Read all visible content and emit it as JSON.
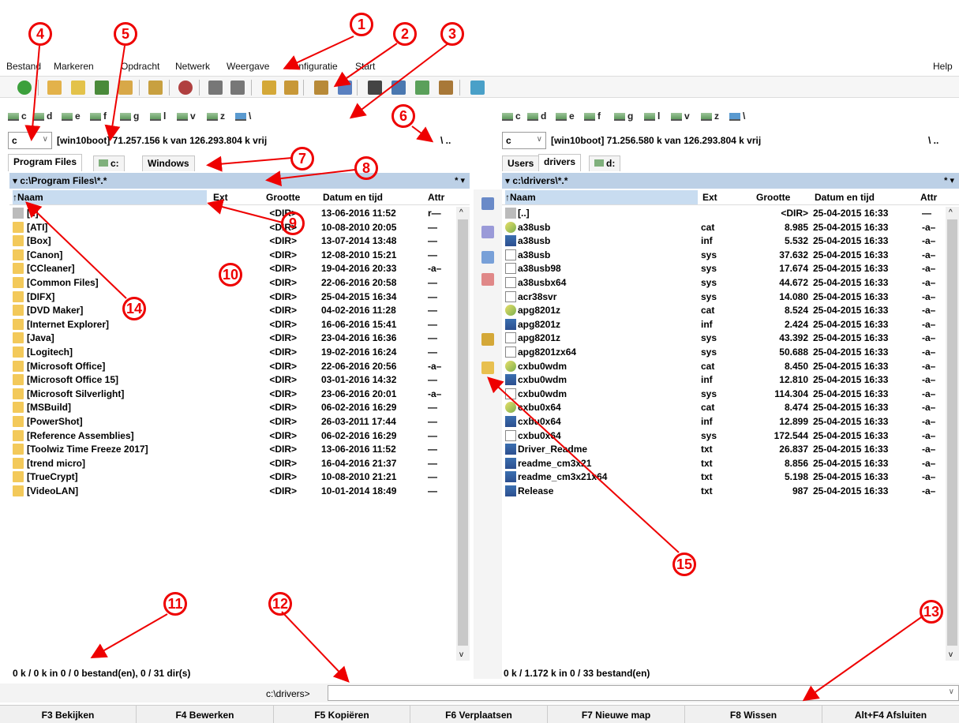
{
  "menu": {
    "items": [
      "Bestand",
      "Markeren",
      "Opdracht",
      "Netwerk",
      "Weergave",
      "Configuratie",
      "Start"
    ],
    "help": "Help"
  },
  "drives": {
    "left": [
      "c",
      "d",
      "e",
      "f",
      "g",
      "l",
      "v",
      "z",
      "\\"
    ],
    "right": [
      "c",
      "d",
      "e",
      "f",
      "g",
      "l",
      "v",
      "z",
      "\\"
    ]
  },
  "left": {
    "drive": "c",
    "free": "[win10boot]  71.257.156 k van 126.293.804 k vrij",
    "root": "\\   ..",
    "tabs": [
      "Program Files",
      "c:",
      "Windows"
    ],
    "path": "c:\\Program Files\\*.*",
    "filter": "*  ▾",
    "columns": {
      "name": "↑Naam",
      "ext": "Ext",
      "size": "Grootte",
      "date": "Datum en tijd",
      "attr": "Attr"
    },
    "rows": [
      {
        "name": "[..]",
        "ext": "",
        "size": "<DIR>",
        "date": "13-06-2016 11:52",
        "attr": "r—"
      },
      {
        "name": "[ATI]",
        "ext": "",
        "size": "<DIR>",
        "date": "10-08-2010 20:05",
        "attr": "—"
      },
      {
        "name": "[Box]",
        "ext": "",
        "size": "<DIR>",
        "date": "13-07-2014 13:48",
        "attr": "—"
      },
      {
        "name": "[Canon]",
        "ext": "",
        "size": "<DIR>",
        "date": "12-08-2010 15:21",
        "attr": "—"
      },
      {
        "name": "[CCleaner]",
        "ext": "",
        "size": "<DIR>",
        "date": "19-04-2016 20:33",
        "attr": "-a–"
      },
      {
        "name": "[Common Files]",
        "ext": "",
        "size": "<DIR>",
        "date": "22-06-2016 20:58",
        "attr": "—"
      },
      {
        "name": "[DIFX]",
        "ext": "",
        "size": "<DIR>",
        "date": "25-04-2015 16:34",
        "attr": "—"
      },
      {
        "name": "[DVD Maker]",
        "ext": "",
        "size": "<DIR>",
        "date": "04-02-2016 11:28",
        "attr": "—"
      },
      {
        "name": "[Internet Explorer]",
        "ext": "",
        "size": "<DIR>",
        "date": "16-06-2016 15:41",
        "attr": "—"
      },
      {
        "name": "[Java]",
        "ext": "",
        "size": "<DIR>",
        "date": "23-04-2016 16:36",
        "attr": "—"
      },
      {
        "name": "[Logitech]",
        "ext": "",
        "size": "<DIR>",
        "date": "19-02-2016 16:24",
        "attr": "—"
      },
      {
        "name": "[Microsoft Office]",
        "ext": "",
        "size": "<DIR>",
        "date": "22-06-2016 20:56",
        "attr": "-a–"
      },
      {
        "name": "[Microsoft Office 15]",
        "ext": "",
        "size": "<DIR>",
        "date": "03-01-2016 14:32",
        "attr": "—"
      },
      {
        "name": "[Microsoft Silverlight]",
        "ext": "",
        "size": "<DIR>",
        "date": "23-06-2016 20:01",
        "attr": "-a–"
      },
      {
        "name": "[MSBuild]",
        "ext": "",
        "size": "<DIR>",
        "date": "06-02-2016 16:29",
        "attr": "—"
      },
      {
        "name": "[PowerShot]",
        "ext": "",
        "size": "<DIR>",
        "date": "26-03-2011 17:44",
        "attr": "—"
      },
      {
        "name": "[Reference Assemblies]",
        "ext": "",
        "size": "<DIR>",
        "date": "06-02-2016 16:29",
        "attr": "—"
      },
      {
        "name": "[Toolwiz Time Freeze 2017]",
        "ext": "",
        "size": "<DIR>",
        "date": "13-06-2016 11:52",
        "attr": "—"
      },
      {
        "name": "[trend micro]",
        "ext": "",
        "size": "<DIR>",
        "date": "16-04-2016 21:37",
        "attr": "—"
      },
      {
        "name": "[TrueCrypt]",
        "ext": "",
        "size": "<DIR>",
        "date": "10-08-2010 21:21",
        "attr": "—"
      },
      {
        "name": "[VideoLAN]",
        "ext": "",
        "size": "<DIR>",
        "date": "10-01-2014 18:49",
        "attr": "—"
      }
    ],
    "status": "0 k / 0 k in 0 / 0 bestand(en), 0 / 31 dir(s)"
  },
  "right": {
    "drive": "c",
    "free": "[win10boot]  71.256.580 k van 126.293.804 k vrij",
    "root": "\\   ..",
    "tabs": [
      "Users",
      "drivers",
      "d:"
    ],
    "path": "c:\\drivers\\*.*",
    "filter": "*  ▾",
    "columns": {
      "name": "↑Naam",
      "ext": "Ext",
      "size": "Grootte",
      "date": "Datum en tijd",
      "attr": "Attr"
    },
    "rows": [
      {
        "name": "[..]",
        "ext": "",
        "size": "<DIR>",
        "date": "25-04-2015 16:33",
        "attr": "—",
        "icon": "up"
      },
      {
        "name": "a38usb",
        "ext": "cat",
        "size": "8.985",
        "date": "25-04-2015 16:33",
        "attr": "-a–",
        "icon": "cat"
      },
      {
        "name": "a38usb",
        "ext": "inf",
        "size": "5.532",
        "date": "25-04-2015 16:33",
        "attr": "-a–",
        "icon": "inf"
      },
      {
        "name": "a38usb",
        "ext": "sys",
        "size": "37.632",
        "date": "25-04-2015 16:33",
        "attr": "-a–",
        "icon": "file"
      },
      {
        "name": "a38usb98",
        "ext": "sys",
        "size": "17.674",
        "date": "25-04-2015 16:33",
        "attr": "-a–",
        "icon": "file"
      },
      {
        "name": "a38usbx64",
        "ext": "sys",
        "size": "44.672",
        "date": "25-04-2015 16:33",
        "attr": "-a–",
        "icon": "file"
      },
      {
        "name": "acr38svr",
        "ext": "sys",
        "size": "14.080",
        "date": "25-04-2015 16:33",
        "attr": "-a–",
        "icon": "file"
      },
      {
        "name": "apg8201z",
        "ext": "cat",
        "size": "8.524",
        "date": "25-04-2015 16:33",
        "attr": "-a–",
        "icon": "cat"
      },
      {
        "name": "apg8201z",
        "ext": "inf",
        "size": "2.424",
        "date": "25-04-2015 16:33",
        "attr": "-a–",
        "icon": "inf"
      },
      {
        "name": "apg8201z",
        "ext": "sys",
        "size": "43.392",
        "date": "25-04-2015 16:33",
        "attr": "-a–",
        "icon": "file"
      },
      {
        "name": "apg8201zx64",
        "ext": "sys",
        "size": "50.688",
        "date": "25-04-2015 16:33",
        "attr": "-a–",
        "icon": "file"
      },
      {
        "name": "cxbu0wdm",
        "ext": "cat",
        "size": "8.450",
        "date": "25-04-2015 16:33",
        "attr": "-a–",
        "icon": "cat"
      },
      {
        "name": "cxbu0wdm",
        "ext": "inf",
        "size": "12.810",
        "date": "25-04-2015 16:33",
        "attr": "-a–",
        "icon": "inf"
      },
      {
        "name": "cxbu0wdm",
        "ext": "sys",
        "size": "114.304",
        "date": "25-04-2015 16:33",
        "attr": "-a–",
        "icon": "file"
      },
      {
        "name": "cxbu0x64",
        "ext": "cat",
        "size": "8.474",
        "date": "25-04-2015 16:33",
        "attr": "-a–",
        "icon": "cat"
      },
      {
        "name": "cxbu0x64",
        "ext": "inf",
        "size": "12.899",
        "date": "25-04-2015 16:33",
        "attr": "-a–",
        "icon": "inf"
      },
      {
        "name": "cxbu0x64",
        "ext": "sys",
        "size": "172.544",
        "date": "25-04-2015 16:33",
        "attr": "-a–",
        "icon": "file"
      },
      {
        "name": "Driver_Readme",
        "ext": "txt",
        "size": "26.837",
        "date": "25-04-2015 16:33",
        "attr": "-a–",
        "icon": "inf"
      },
      {
        "name": "readme_cm3x21",
        "ext": "txt",
        "size": "8.856",
        "date": "25-04-2015 16:33",
        "attr": "-a–",
        "icon": "inf"
      },
      {
        "name": "readme_cm3x21x64",
        "ext": "txt",
        "size": "5.198",
        "date": "25-04-2015 16:33",
        "attr": "-a–",
        "icon": "inf"
      },
      {
        "name": "Release",
        "ext": "txt",
        "size": "987",
        "date": "25-04-2015 16:33",
        "attr": "-a–",
        "icon": "inf"
      }
    ],
    "status": "0 k / 1.172 k in 0 / 33 bestand(en)"
  },
  "cmdline": {
    "label": "c:\\drivers>",
    "value": ""
  },
  "fkeys": [
    "F3 Bekijken",
    "F4 Bewerken",
    "F5 Kopiëren",
    "F6 Verplaatsen",
    "F7 Nieuwe map",
    "F8 Wissen",
    "Alt+F4 Afsluiten"
  ],
  "annotations": [
    "1",
    "2",
    "3",
    "4",
    "5",
    "6",
    "7",
    "8",
    "9",
    "10",
    "11",
    "12",
    "13",
    "14",
    "15"
  ],
  "colors": {
    "annotation": "#e00000",
    "path_header": "#bcd0e6",
    "folder": "#f3c95a"
  }
}
